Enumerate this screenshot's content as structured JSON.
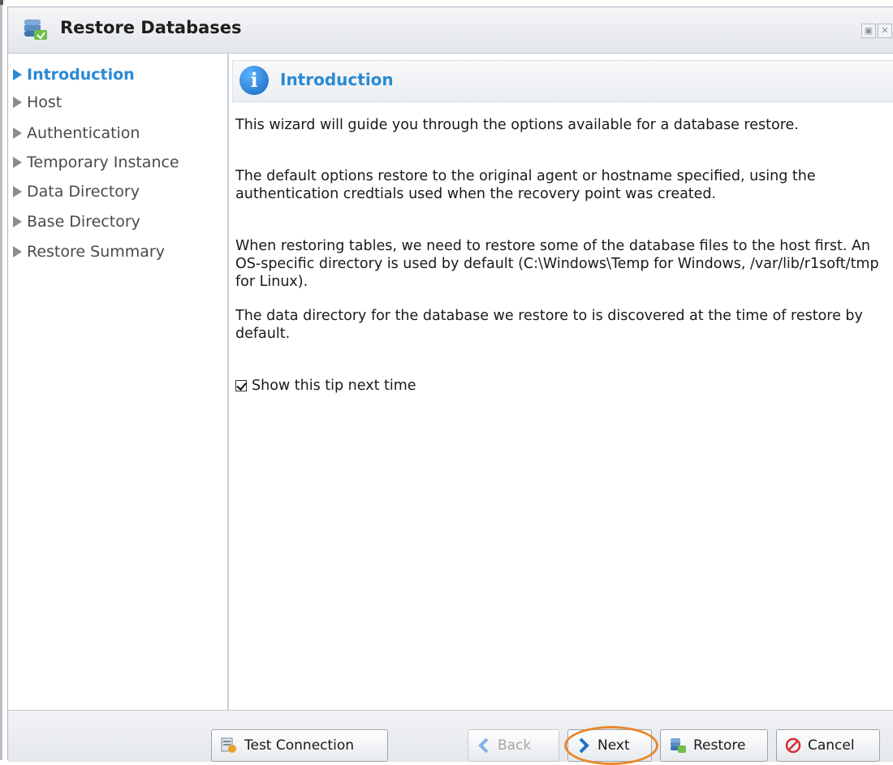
{
  "window": {
    "title": "Restore Databases"
  },
  "sidebar": {
    "items": [
      {
        "label": "Introduction",
        "active": true
      },
      {
        "label": "Host",
        "active": false
      },
      {
        "label": "Authentication",
        "active": false
      },
      {
        "label": "Temporary Instance",
        "active": false
      },
      {
        "label": "Data Directory",
        "active": false
      },
      {
        "label": "Base Directory",
        "active": false
      },
      {
        "label": "Restore Summary",
        "active": false
      }
    ]
  },
  "content": {
    "header_title": "Introduction",
    "header_icon": "info-icon",
    "paragraphs": [
      "This wizard will guide you through the options available for a database restore.",
      "The default options restore to the original agent or hostname specified, using the authentication credtials used when the recovery point was created.",
      "When restoring tables, we need to restore some of the database files to the host first. An OS-specific directory is used by default (C:\\Windows\\Temp for Windows, /var/lib/r1soft/tmp for Linux).",
      "The data directory for the database we restore to is discovered at the time of restore by default."
    ],
    "show_tip_label": "Show this tip next time",
    "show_tip_checked": true
  },
  "footer": {
    "test_connection_label": "Test Connection",
    "back_label": "Back",
    "next_label": "Next",
    "restore_label": "Restore",
    "cancel_label": "Cancel"
  },
  "colors": {
    "accent": "#2a8ad4",
    "highlight_ring": "#e8892a",
    "cancel_red": "#d32f2f"
  }
}
